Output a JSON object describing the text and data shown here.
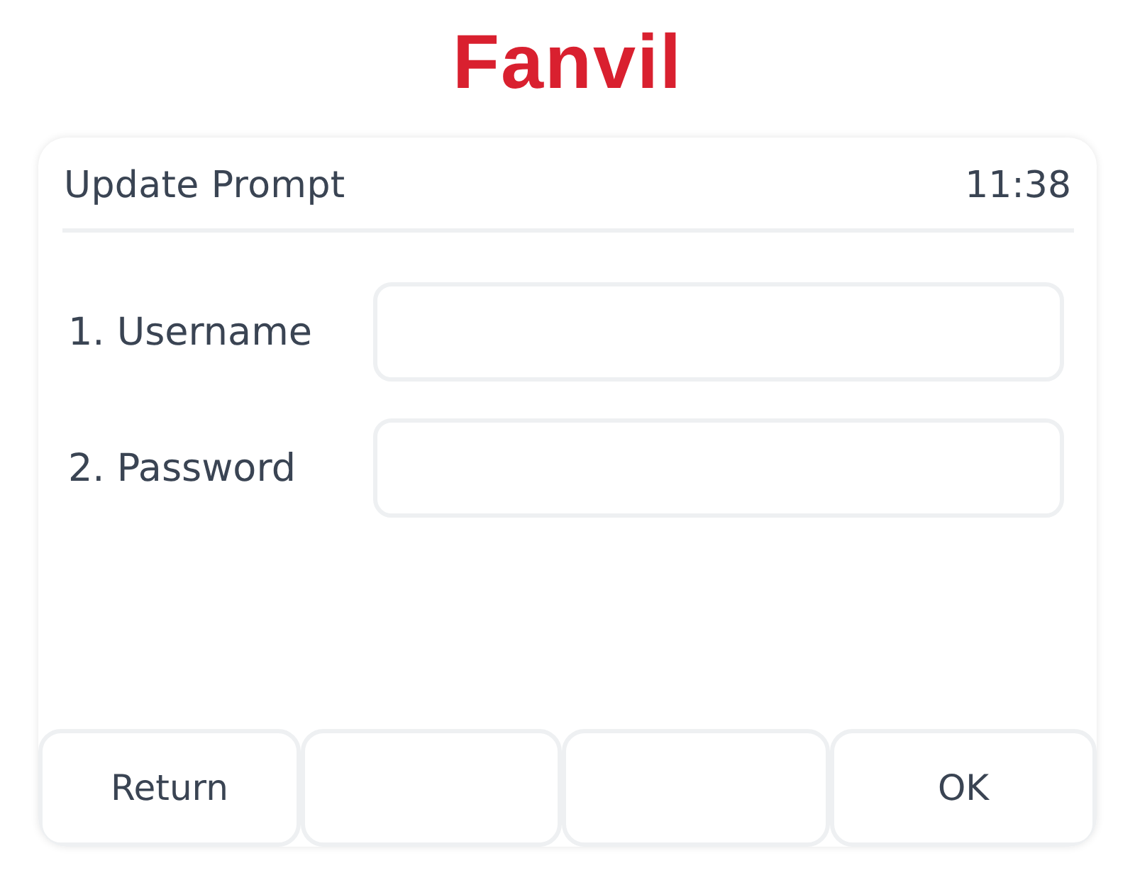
{
  "logo": {
    "text": "Fanvil"
  },
  "header": {
    "title": "Update Prompt",
    "time": "11:38"
  },
  "fields": [
    {
      "label": "1. Username"
    },
    {
      "label": "2. Password"
    }
  ],
  "softkeys": [
    {
      "kind": "labeled",
      "label": "Return"
    },
    {
      "kind": "blank"
    },
    {
      "kind": "blank"
    },
    {
      "kind": "labeled",
      "label": "OK"
    }
  ]
}
